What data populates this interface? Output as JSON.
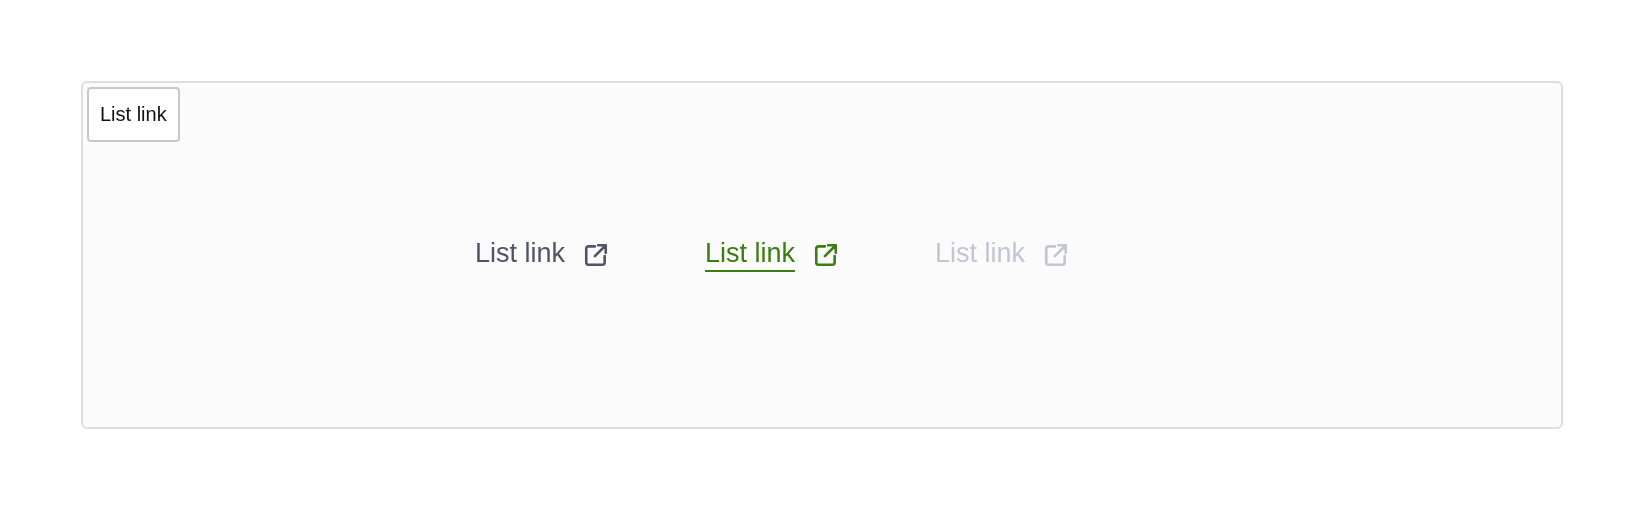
{
  "label": "List link",
  "links": [
    {
      "text": "List link",
      "hovered": false,
      "disabled": false
    },
    {
      "text": "List link",
      "hovered": true,
      "disabled": false
    },
    {
      "text": "List link",
      "hovered": false,
      "disabled": true
    }
  ]
}
